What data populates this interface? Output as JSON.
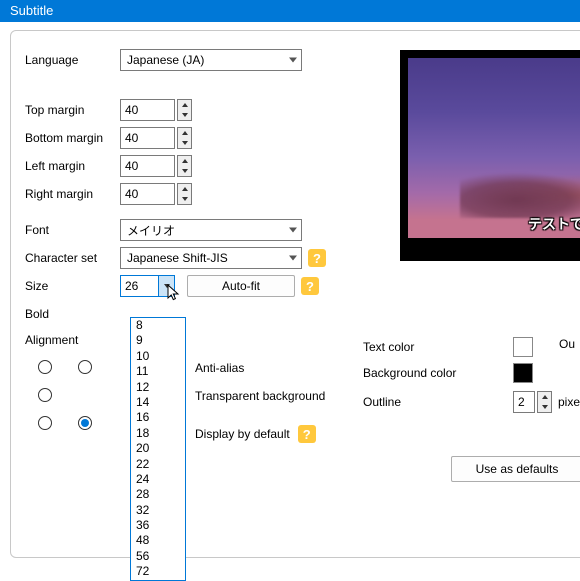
{
  "window": {
    "title": "Subtitle"
  },
  "labels": {
    "language": "Language",
    "top_margin": "Top margin",
    "bottom_margin": "Bottom margin",
    "left_margin": "Left margin",
    "right_margin": "Right margin",
    "font": "Font",
    "character_set": "Character set",
    "size": "Size",
    "bold": "Bold",
    "alignment": "Alignment",
    "anti_alias": "Anti-alias",
    "transparent_bg": "Transparent background",
    "display_default": "Display by default",
    "text_color": "Text color",
    "background_color": "Background color",
    "outline": "Outline",
    "outline_units": "pixels",
    "out_trunc": "Ou"
  },
  "values": {
    "language": "Japanese (JA)",
    "top_margin": "40",
    "bottom_margin": "40",
    "left_margin": "40",
    "right_margin": "40",
    "font": "メイリオ",
    "character_set": "Japanese Shift-JIS",
    "size": "26",
    "outline": "2",
    "text_color": "#ffffff",
    "background_color": "#000000"
  },
  "buttons": {
    "auto_fit": "Auto-fit",
    "use_defaults": "Use as defaults"
  },
  "dropdown": {
    "size_options": [
      "8",
      "9",
      "10",
      "11",
      "12",
      "14",
      "16",
      "18",
      "20",
      "22",
      "24",
      "28",
      "32",
      "36",
      "48",
      "56",
      "72"
    ]
  },
  "preview": {
    "subtitle_sample": "テストです"
  },
  "help_glyph": "?"
}
